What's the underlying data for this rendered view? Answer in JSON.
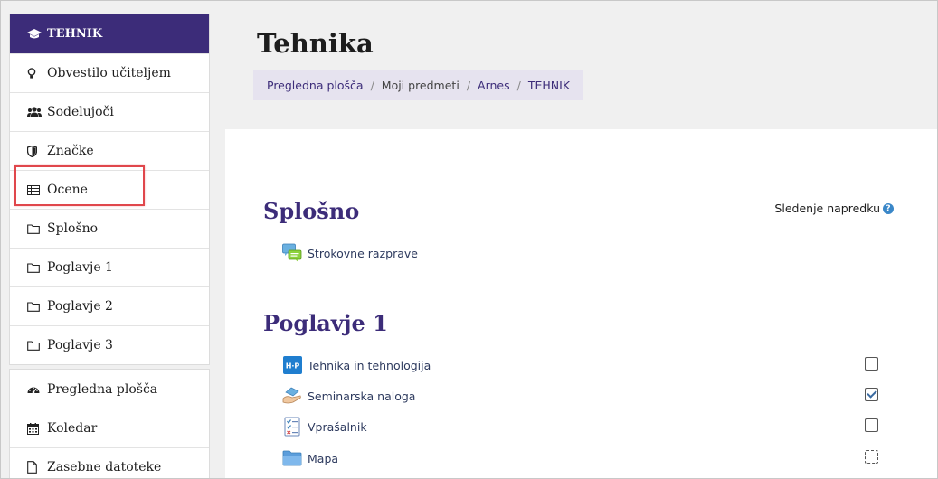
{
  "sidebar": {
    "course": {
      "label": "TEHNIK",
      "icon": "graduation-cap-icon"
    },
    "course_items": [
      {
        "label": "Obvestilo učiteljem",
        "icon": "lightbulb-icon"
      },
      {
        "label": "Sodelujoči",
        "icon": "users-icon"
      },
      {
        "label": "Značke",
        "icon": "shield-icon"
      },
      {
        "label": "Ocene",
        "icon": "table-icon"
      },
      {
        "label": "Splošno",
        "icon": "folder-icon"
      },
      {
        "label": "Poglavje 1",
        "icon": "folder-icon"
      },
      {
        "label": "Poglavje 2",
        "icon": "folder-icon"
      },
      {
        "label": "Poglavje 3",
        "icon": "folder-icon"
      }
    ],
    "site_items": [
      {
        "label": "Pregledna plošča",
        "icon": "dashboard-icon"
      },
      {
        "label": "Koledar",
        "icon": "calendar-icon"
      },
      {
        "label": "Zasebne datoteke",
        "icon": "file-icon"
      }
    ]
  },
  "header": {
    "title": "Tehnika",
    "breadcrumb": [
      "Pregledna plošča",
      "Moji predmeti",
      "Arnes",
      "TEHNIK"
    ]
  },
  "main": {
    "progress_label": "Sledenje napredku",
    "sections": [
      {
        "title": "Splošno",
        "activities": [
          {
            "label": "Strokovne razprave",
            "icon": "forum-icon"
          }
        ]
      },
      {
        "title": "Poglavje 1",
        "activities": [
          {
            "label": "Tehnika in tehnologija",
            "icon": "h5p-icon",
            "completion": "unchecked"
          },
          {
            "label": "Seminarska naloga",
            "icon": "assignment-icon",
            "completion": "checked"
          },
          {
            "label": "Vprašalnik",
            "icon": "quiz-icon",
            "completion": "unchecked"
          },
          {
            "label": "Mapa",
            "icon": "folder-icon",
            "completion": "manual-dashed"
          }
        ]
      }
    ]
  },
  "colors": {
    "brand": "#3c2c79",
    "highlight": "#e0474c"
  }
}
